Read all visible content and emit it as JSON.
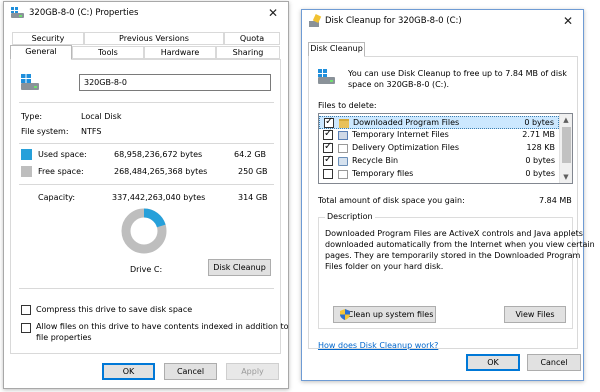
{
  "properties": {
    "title": "320GB-8-0 (C:) Properties",
    "tabs_top": [
      "Security",
      "Previous Versions",
      "Quota"
    ],
    "tabs_bottom": [
      "General",
      "Tools",
      "Hardware",
      "Sharing"
    ],
    "active_tab": "General",
    "drive_name": "320GB-8-0",
    "type_label": "Type:",
    "type_value": "Local Disk",
    "fs_label": "File system:",
    "fs_value": "NTFS",
    "used_label": "Used space:",
    "used_bytes": "68,958,236,672 bytes",
    "used_gb": "64.2 GB",
    "free_label": "Free space:",
    "free_bytes": "268,484,265,368 bytes",
    "free_gb": "250 GB",
    "capacity_label": "Capacity:",
    "capacity_bytes": "337,442,263,040 bytes",
    "capacity_gb": "314 GB",
    "used_fraction": 0.204,
    "drive_label": "Drive C:",
    "disk_cleanup_button": "Disk Cleanup",
    "compress_label": "Compress this drive to save disk space",
    "index_label_line1": "Allow files on this drive to have contents indexed in addition to",
    "index_label_line2": "file properties",
    "ok": "OK",
    "cancel": "Cancel",
    "apply": "Apply",
    "colors": {
      "used": "#26a0da",
      "free": "#bebebe"
    }
  },
  "cleanup": {
    "title": "Disk Cleanup for 320GB-8-0 (C:)",
    "tab": "Disk Cleanup",
    "intro_line1": "You can use Disk Cleanup to free up to 7.84 MB of disk",
    "intro_line2": "space on 320GB-8-0 (C:).",
    "files_to_delete": "Files to delete:",
    "files": [
      {
        "name": "Downloaded Program Files",
        "size": "0 bytes",
        "checked": true,
        "selected": true,
        "icon": "folder-icon"
      },
      {
        "name": "Temporary Internet Files",
        "size": "2.71 MB",
        "checked": true,
        "selected": false,
        "icon": "internet-files-icon"
      },
      {
        "name": "Delivery Optimization Files",
        "size": "128 KB",
        "checked": true,
        "selected": false,
        "icon": "file-icon"
      },
      {
        "name": "Recycle Bin",
        "size": "0 bytes",
        "checked": true,
        "selected": false,
        "icon": "recycle-bin-icon"
      },
      {
        "name": "Temporary files",
        "size": "0 bytes",
        "checked": false,
        "selected": false,
        "icon": "file-icon"
      }
    ],
    "total_label": "Total amount of disk space you gain:",
    "total_value": "7.84 MB",
    "description_title": "Description",
    "description_lines": [
      "Downloaded Program Files are ActiveX controls and Java applets",
      "downloaded automatically from the Internet when you view certain",
      "pages. They are temporarily stored in the Downloaded Program",
      "Files folder on your hard disk."
    ],
    "clean_system_button": "Clean up system files",
    "view_files_button": "View Files",
    "how_link": "How does Disk Cleanup work?",
    "ok": "OK",
    "cancel": "Cancel"
  }
}
